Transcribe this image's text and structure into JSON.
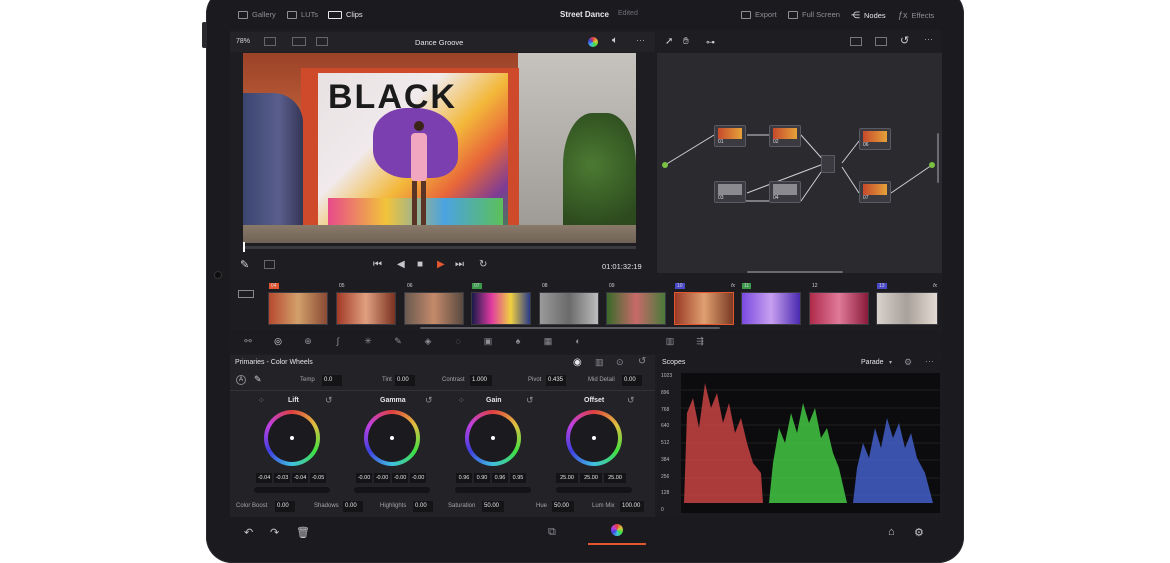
{
  "topbar": {
    "gallery": "Gallery",
    "luts": "LUTs",
    "clips": "Clips",
    "project_title": "Street Dance",
    "project_status": "Edited",
    "export": "Export",
    "full_screen": "Full Screen",
    "nodes": "Nodes",
    "effects": "Effects"
  },
  "viewer": {
    "zoom": "78%",
    "clip_name": "Dance Groove",
    "timecode": "01:01:32:19",
    "mural_text": "BLACK"
  },
  "timeline": {
    "clips": [
      {
        "num": "04"
      },
      {
        "num": "05"
      },
      {
        "num": "06"
      },
      {
        "num": "07"
      },
      {
        "num": "08"
      },
      {
        "num": "09"
      },
      {
        "num": "10",
        "fx": "fx"
      },
      {
        "num": "11"
      },
      {
        "num": "12"
      },
      {
        "num": "13",
        "fx": "fx"
      }
    ]
  },
  "nodes": [
    {
      "label": "01"
    },
    {
      "label": "02"
    },
    {
      "label": "03"
    },
    {
      "label": "04"
    },
    {
      "label": "06"
    },
    {
      "label": "07"
    }
  ],
  "primaries": {
    "title": "Primaries - Color Wheels",
    "temp_label": "Temp",
    "temp": "0.0",
    "tint_label": "Tint",
    "tint": "0.00",
    "contrast_label": "Contrast",
    "contrast": "1.000",
    "pivot_label": "Pivot",
    "pivot": "0.435",
    "middetail_label": "Mid Detail",
    "middetail": "0.00",
    "wheels": [
      {
        "name": "Lift",
        "values": [
          "-0.04",
          "-0.03",
          "-0.04",
          "-0.05"
        ]
      },
      {
        "name": "Gamma",
        "values": [
          "-0.00",
          "-0.00",
          "-0.00",
          "-0.00"
        ]
      },
      {
        "name": "Gain",
        "values": [
          "0.96",
          "0.90",
          "0.96",
          "0.95"
        ]
      },
      {
        "name": "Offset",
        "values": [
          "25.00",
          "25.00",
          "25.00"
        ]
      }
    ],
    "color_boost_label": "Color Boost",
    "color_boost": "0.00",
    "shadows_label": "Shadows",
    "shadows": "0.00",
    "highlights_label": "Highlights",
    "highlights": "0.00",
    "saturation_label": "Saturation",
    "saturation": "50.00",
    "hue_label": "Hue",
    "hue": "50.00",
    "lummix_label": "Lum Mix",
    "lummix": "100.00"
  },
  "scopes": {
    "title": "Scopes",
    "mode": "Parade",
    "y_labels": [
      "1023",
      "896",
      "768",
      "640",
      "512",
      "384",
      "256",
      "128",
      "0"
    ]
  }
}
